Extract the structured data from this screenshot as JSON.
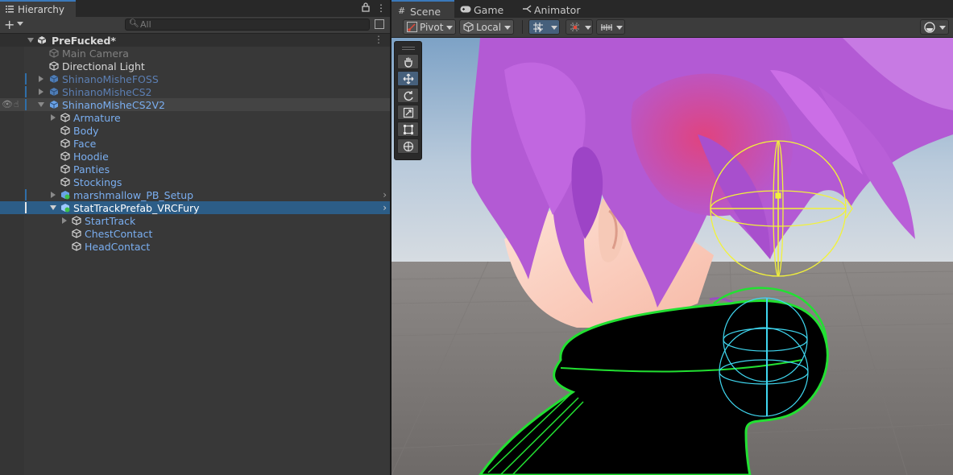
{
  "hierarchy": {
    "tab_label": "Hierarchy",
    "search_placeholder": "All",
    "scene_name": "PreFucked*",
    "rows": [
      {
        "label": "Main Camera"
      },
      {
        "label": "Directional Light"
      },
      {
        "label": "ShinanoMisheFOSS"
      },
      {
        "label": "ShinanoMisheCS2"
      },
      {
        "label": "ShinanoMisheCS2V2"
      },
      {
        "label": "Armature"
      },
      {
        "label": "Body"
      },
      {
        "label": "Face"
      },
      {
        "label": "Hoodie"
      },
      {
        "label": "Panties"
      },
      {
        "label": "Stockings"
      },
      {
        "label": "marshmallow_PB_Setup"
      },
      {
        "label": "StatTrackPrefab_VRCFury"
      },
      {
        "label": "StartTrack"
      },
      {
        "label": "ChestContact"
      },
      {
        "label": "HeadContact"
      }
    ]
  },
  "scene_view": {
    "tabs": [
      {
        "label": "Scene",
        "icon": "grid-icon"
      },
      {
        "label": "Game",
        "icon": "gamepad-icon"
      },
      {
        "label": "Animator",
        "icon": "animator-icon"
      }
    ],
    "toolbar": {
      "pivot_label": "Pivot",
      "local_label": "Local"
    },
    "tools": [
      "hand-tool",
      "move-tool",
      "rotate-tool",
      "scale-tool",
      "rect-tool",
      "transform-tool"
    ]
  },
  "colors": {
    "accent": "#3a79bb",
    "selection": "#2c5d87",
    "prefab_text": "#6d9de3",
    "hair_purple": "#b35ad4",
    "hair_pink": "#e0437f",
    "outline_green": "#22e032",
    "gizmo_yellow": "#f2f23a",
    "gizmo_cyan": "#3fd7f0"
  }
}
